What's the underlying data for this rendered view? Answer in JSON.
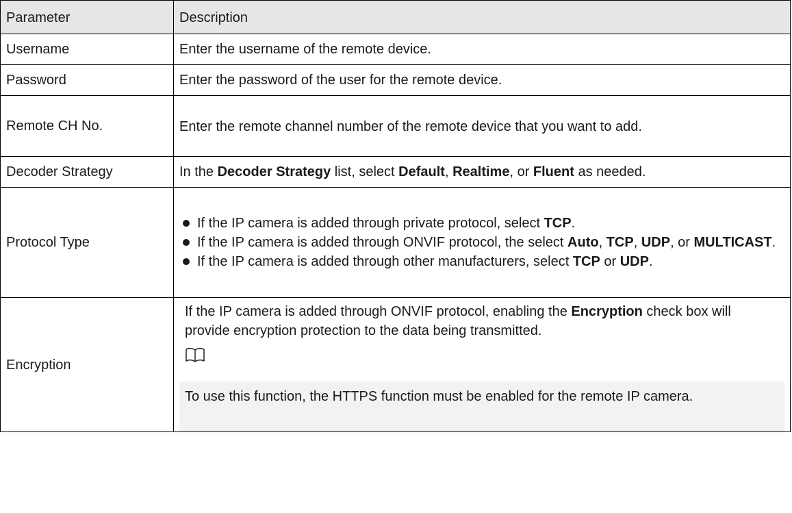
{
  "table": {
    "headers": {
      "parameter": "Parameter",
      "description": "Description"
    },
    "rows": {
      "username": {
        "param": "Username",
        "desc": "Enter the username of the remote device."
      },
      "password": {
        "param": "Password",
        "desc": "Enter the password of the user for the remote device."
      },
      "remote_ch": {
        "param": "Remote CH No.",
        "desc": "Enter the remote channel number of the remote device that you want to add."
      },
      "decoder": {
        "param": "Decoder Strategy",
        "t1": "In the ",
        "b1": "Decoder Strategy",
        "t2": " list, select ",
        "b2": "Default",
        "t3": ", ",
        "b3": "Realtime",
        "t4": ", or ",
        "b4": "Fluent",
        "t5": " as needed."
      },
      "protocol": {
        "param": "Protocol Type",
        "bullet1": {
          "t1": "If the IP camera is added through private protocol, select ",
          "b1": "TCP",
          "t2": "."
        },
        "bullet2": {
          "t1": "If the IP camera is added through ONVIF protocol, the select ",
          "b1": "Auto",
          "t2": ", ",
          "b2": "TCP",
          "t3": ", ",
          "b3": "UDP",
          "t4": ", or ",
          "b4": "MULTICAST",
          "t5": "."
        },
        "bullet3": {
          "t1": "If the IP camera is added through other manufacturers, select ",
          "b1": "TCP",
          "t2": " or ",
          "b2": "UDP",
          "t3": "."
        }
      },
      "encryption": {
        "param": "Encryption",
        "t1": "If the IP camera is added through ONVIF protocol, enabling the ",
        "b1": "Encryption",
        "t2": " check box will provide encryption protection to the data being transmitted.",
        "note_icon": "book-icon",
        "note": "To use this function, the HTTPS function must be enabled for the remote IP camera."
      }
    }
  }
}
